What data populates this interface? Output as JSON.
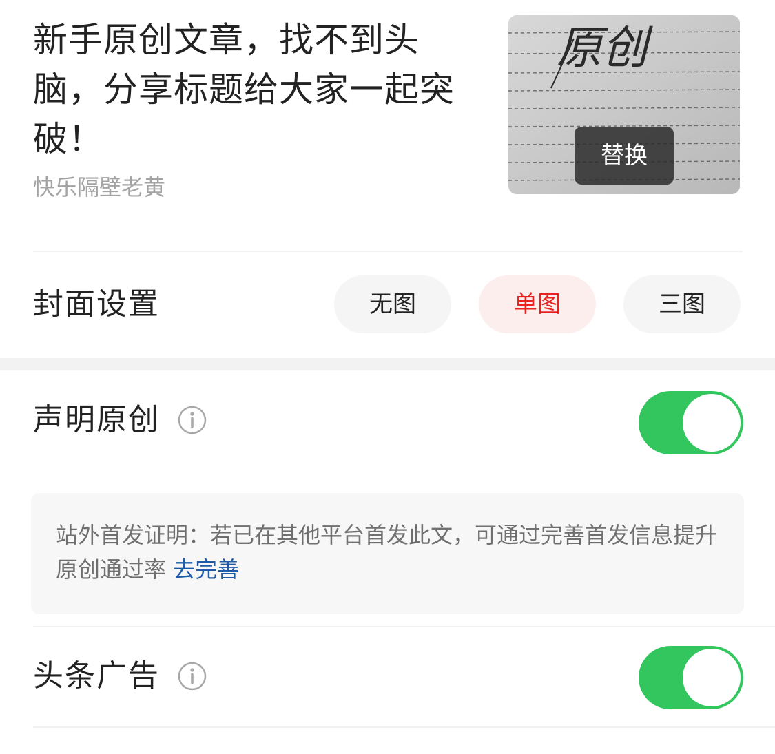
{
  "article": {
    "title": "新手原创文章，找不到头脑，分享标题给大家一起突破！",
    "author": "快乐隔壁老黄",
    "cover_handwriting": "原创",
    "replace_label": "替换"
  },
  "cover_setting": {
    "label": "封面设置",
    "options": [
      "无图",
      "单图",
      "三图"
    ],
    "selected": "单图"
  },
  "declare_original": {
    "label": "声明原创",
    "info_icon": "info-circle-icon",
    "enabled": true,
    "notice_text": "站外首发证明：若已在其他平台首发此文，可通过完善首发信息提升原创通过率",
    "notice_link": "去完善"
  },
  "headline_ads": {
    "label": "头条广告",
    "info_icon": "info-circle-icon",
    "enabled": true
  },
  "colors": {
    "toggle_on": "#33c55e",
    "active_pill_text": "#e8221e",
    "active_pill_bg": "#fdeeee",
    "link": "#1d5aa8"
  }
}
